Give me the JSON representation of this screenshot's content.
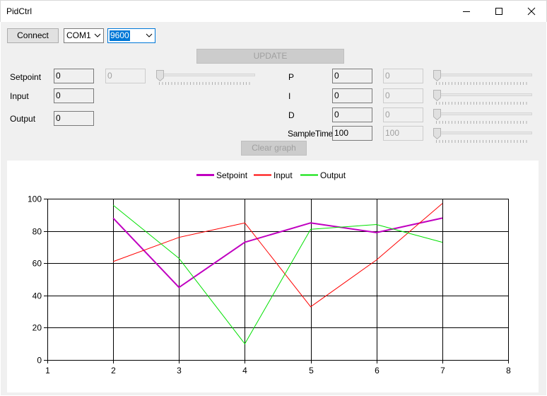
{
  "window": {
    "title": "PidCtrl"
  },
  "toolbar": {
    "connect_label": "Connect",
    "port_value": "COM1",
    "baud_value": "9600",
    "update_label": "UPDATE",
    "clear_label": "Clear graph"
  },
  "left_params": {
    "setpoint": {
      "label": "Setpoint",
      "value": "0",
      "readback": "0"
    },
    "input": {
      "label": "Input",
      "value": "0"
    },
    "output": {
      "label": "Output",
      "value": "0"
    }
  },
  "right_params": {
    "p": {
      "label": "P",
      "value": "0",
      "readback": "0"
    },
    "i": {
      "label": "I",
      "value": "0",
      "readback": "0"
    },
    "d": {
      "label": "D",
      "value": "0",
      "readback": "0"
    },
    "sample_time": {
      "label": "SampleTime",
      "value": "100",
      "readback": "100"
    }
  },
  "chart_data": {
    "type": "line",
    "xlim": [
      1,
      8
    ],
    "ylim": [
      0,
      100
    ],
    "x_ticks": [
      1,
      2,
      3,
      4,
      5,
      6,
      7,
      8
    ],
    "y_ticks": [
      0,
      20,
      40,
      60,
      80,
      100
    ],
    "grid": true,
    "legend_position": "top-center",
    "series": [
      {
        "name": "Setpoint",
        "color": "#c000c0",
        "width": 2,
        "x": [
          2,
          3,
          4,
          5,
          6,
          7
        ],
        "y": [
          88,
          45,
          73,
          85,
          79,
          88
        ]
      },
      {
        "name": "Input",
        "color": "#ff0000",
        "width": 1,
        "x": [
          2,
          3,
          4,
          5,
          6,
          7
        ],
        "y": [
          61,
          76,
          85,
          33,
          62,
          97
        ]
      },
      {
        "name": "Output",
        "color": "#00e000",
        "width": 1,
        "x": [
          2,
          3,
          4,
          5,
          6,
          7
        ],
        "y": [
          96,
          63,
          10,
          81,
          84,
          73
        ]
      }
    ]
  }
}
